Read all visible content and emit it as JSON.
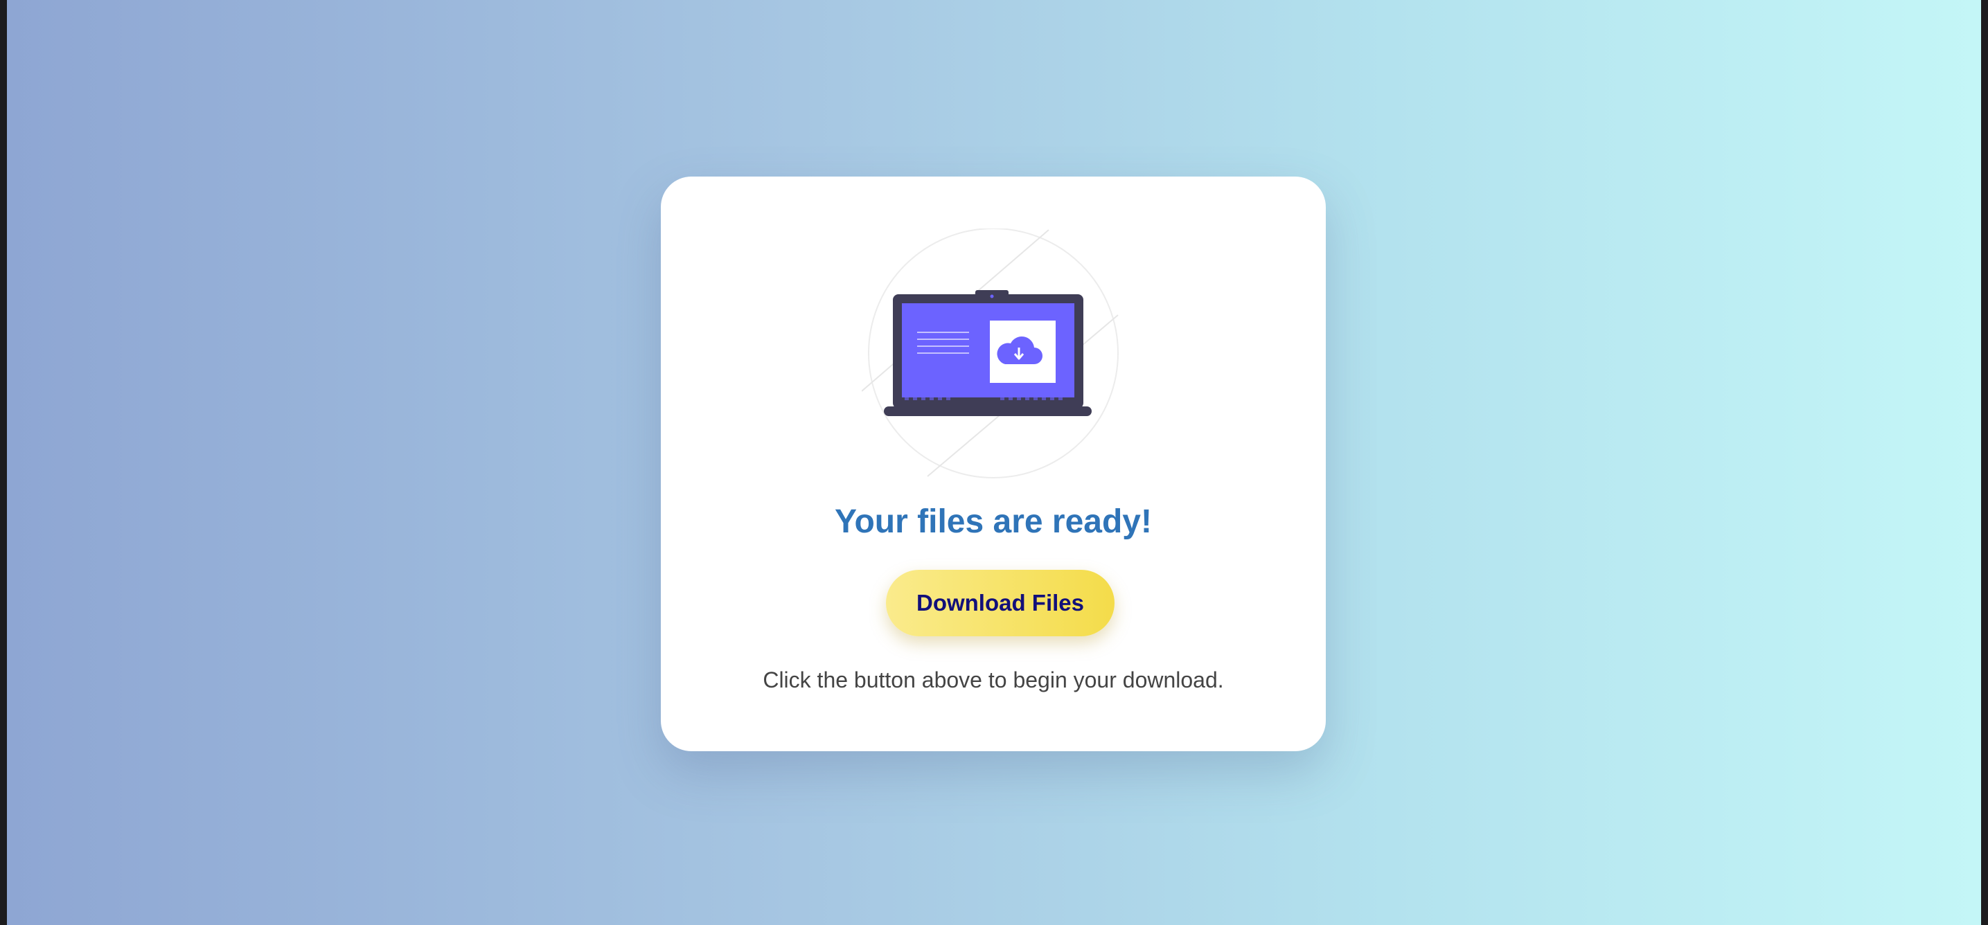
{
  "colors": {
    "heading": "#2f74b8",
    "button_gradient_start": "#faeb8c",
    "button_gradient_end": "#f4dc4a",
    "button_text": "#12107a",
    "laptop_body": "#3f3d56",
    "screen_accent": "#6c63ff",
    "body_text": "#444444"
  },
  "illustration": {
    "icon": "laptop-cloud-download-icon"
  },
  "card": {
    "heading": "Your files are ready!",
    "button_label": "Download Files",
    "instruction": "Click the button above to begin your download."
  }
}
